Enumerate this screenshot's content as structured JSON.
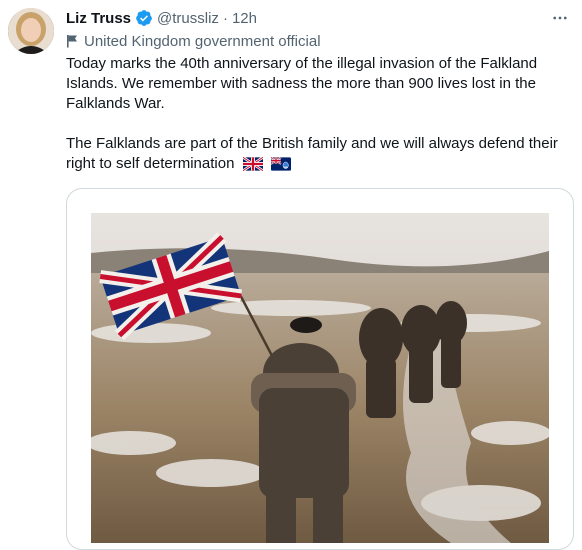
{
  "author": {
    "name": "Liz Truss",
    "handle": "@trussliz",
    "separator": "·",
    "time": "12h",
    "verified_icon": "verified-badge-icon"
  },
  "account_label": "United Kingdom government official",
  "more_icon": "more-options-icon",
  "tweet": {
    "paragraph1": "Today marks the 40th anniversary of the illegal invasion of the Falkland Islands. We remember with sadness the more than 900 lives lost in the Falklands War.",
    "paragraph2": "The Falklands are part of the British family and we will always defend their right to self determination"
  },
  "emojis": [
    "uk-flag-emoji",
    "falkland-islands-flag-emoji"
  ],
  "colors": {
    "text": "#0f1419",
    "secondary": "#536471",
    "verified": "#1d9bf0",
    "border": "#cfd9de"
  }
}
